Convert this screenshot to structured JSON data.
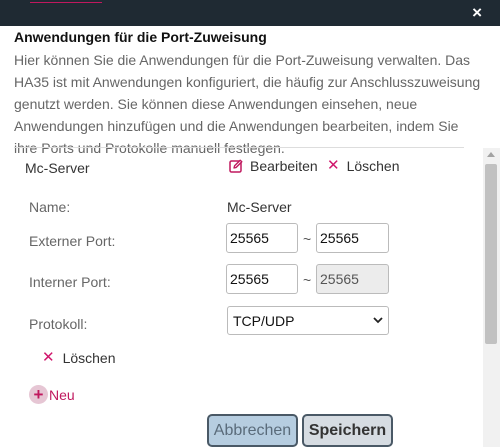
{
  "window": {
    "close_icon": "×"
  },
  "header": {
    "title": "Anwendungen für die Port-Zuweisung",
    "description": "Hier können Sie die Anwendungen für die Port-Zuweisung verwalten. Das HA35 ist mit Anwendungen konfiguriert, die häufig zur Anschlusszuweisung genutzt werden. Sie können diese Anwendungen einsehen, neue Anwendungen hinzufügen und die Anwendungen bearbeiten, indem Sie ihre Ports und Protokolle manuell festlegen."
  },
  "app": {
    "name": "Mc-Server",
    "edit_label": "Bearbeiten",
    "delete_label": "Löschen"
  },
  "form": {
    "name_label": "Name:",
    "name_value": "Mc-Server",
    "external_port_label": "Externer Port:",
    "external_port_from": "25565",
    "external_port_to": "25565",
    "internal_port_label": "Interner Port:",
    "internal_port_from": "25565",
    "internal_port_to": "25565",
    "range_separator": "~",
    "protocol_label": "Protokoll:",
    "protocol_value": "TCP/UDP",
    "delete_label": "Löschen"
  },
  "actions": {
    "new_label": "Neu",
    "cancel_label": "Abbrechen",
    "save_label": "Speichern"
  },
  "icons": {
    "edit": "edit-icon",
    "delete": "delete-x-icon",
    "new": "plus-circle-icon",
    "dropdown": "chevron-down-icon"
  },
  "colors": {
    "accent": "#c0185e",
    "titlebar": "#1f2a33",
    "cancel_bg": "#b6cde0",
    "save_bg": "#d6dce2"
  }
}
